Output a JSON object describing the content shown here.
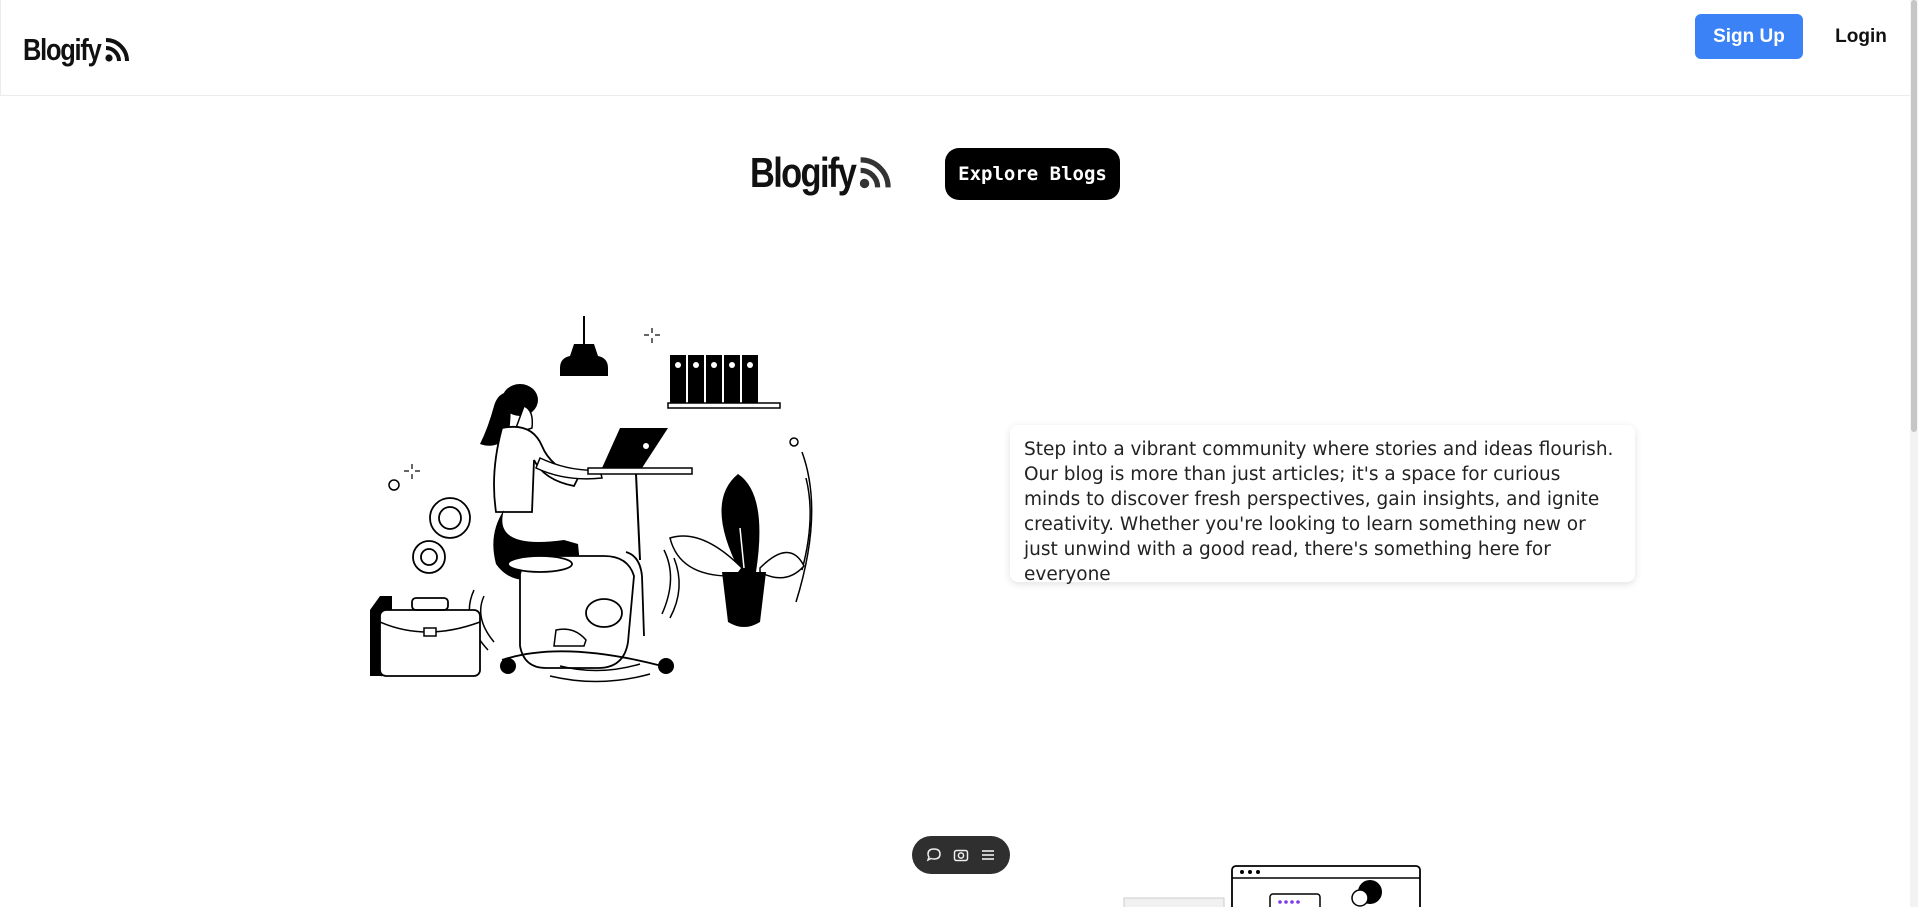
{
  "navbar": {
    "brand": "Blogify",
    "signup_label": "Sign Up",
    "login_label": "Login"
  },
  "hero": {
    "brand": "Blogify",
    "explore_label": "Explore Blogs",
    "description": "Step into a vibrant community where stories and ideas flourish. Our blog is more than just articles; it's a space for curious minds to discover fresh perspectives, gain insights, and ignite creativity. Whether you're looking to learn something new or just unwind with a good read, there's something here for everyone"
  },
  "toolbar": {
    "icons": [
      "chat-icon",
      "camera-icon",
      "menu-icon"
    ]
  },
  "colors": {
    "accent": "#3b82f6",
    "dark": "#000000"
  }
}
